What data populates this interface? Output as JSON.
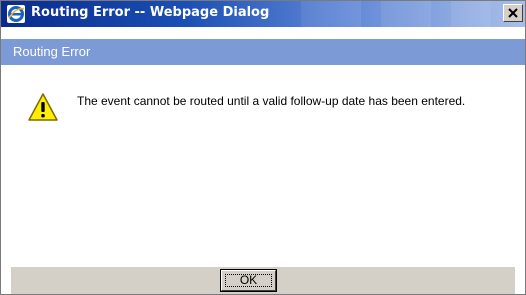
{
  "window": {
    "title": "Routing Error -- Webpage Dialog",
    "title_icon": "internet-explorer-icon",
    "close_icon": "close-icon"
  },
  "header": {
    "title": "Routing Error"
  },
  "content": {
    "icon": "warning-icon",
    "message": "The event cannot be routed until a valid follow-up date has been entered."
  },
  "footer": {
    "ok_label": "OK"
  },
  "colors": {
    "titlebar_dark": "#0a2a8c",
    "titlebar_light": "#a9bfe8",
    "header_band": "#7b9ad6",
    "footer_bg": "#d4d0c8",
    "warning_fill": "#ffee00"
  }
}
